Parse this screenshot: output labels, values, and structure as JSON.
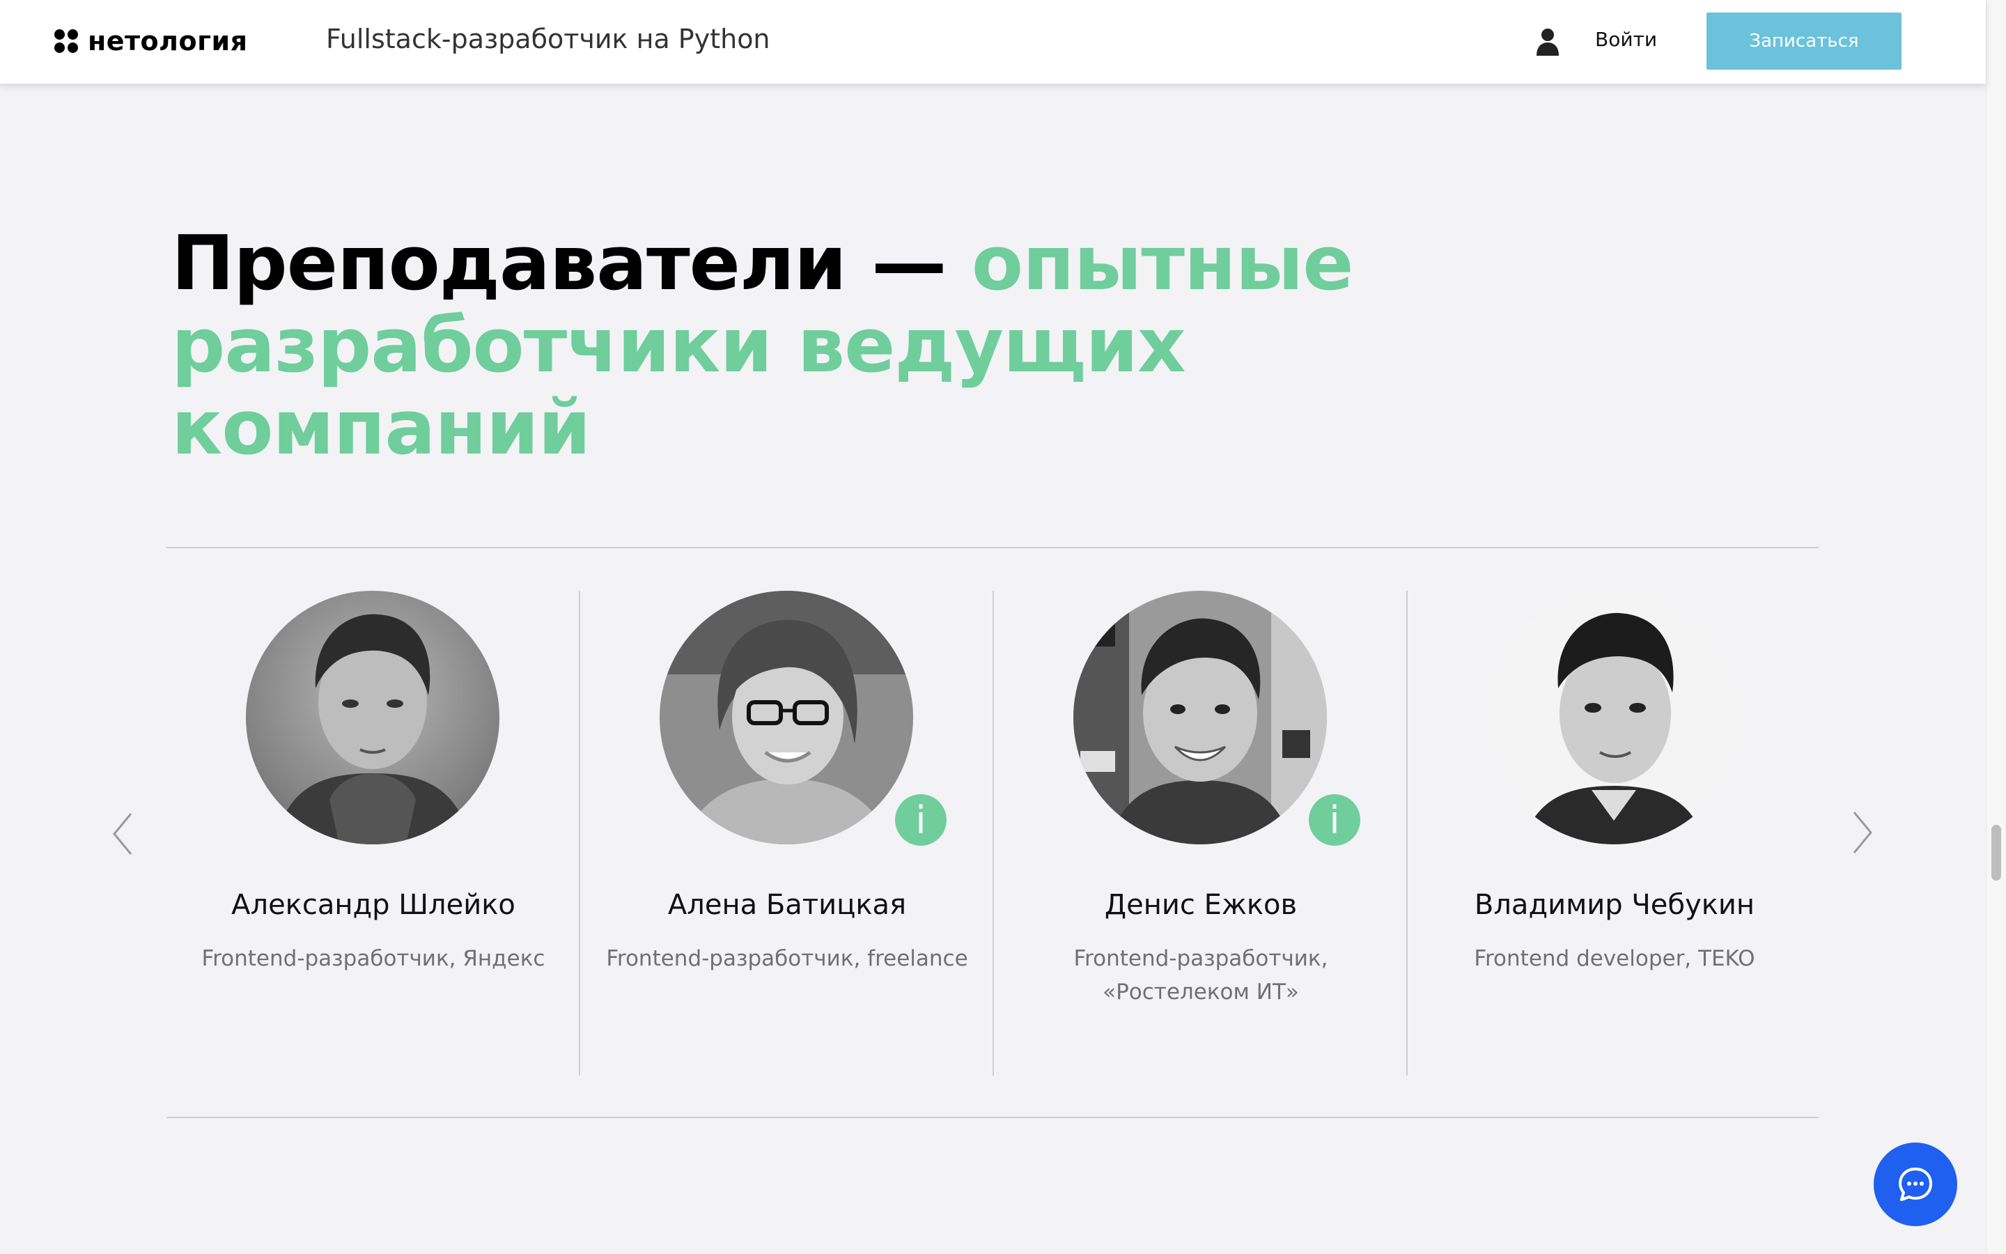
{
  "header": {
    "logo_text": "нетология",
    "course_title": "Fullstack-разработчик на Python",
    "login_label": "Войти",
    "signup_label": "Записаться",
    "icons": {
      "user": "user-icon",
      "logo": "logo-mark-icon"
    }
  },
  "section": {
    "heading_black": "Преподаватели — ",
    "heading_green": "опытные разработчики ведущих компаний"
  },
  "teachers": [
    {
      "name": "Александр Шлейко",
      "role": "Frontend-разработчик, Яндекс",
      "info": false
    },
    {
      "name": "Алена Батицкая",
      "role": "Frontend-разработчик, freelance",
      "info": true
    },
    {
      "name": "Денис Ежков",
      "role": "Frontend-разработчик, «Ростелеком ИТ»",
      "info": true
    },
    {
      "name": "Владимир Чебукин",
      "role": "Frontend developer, TEKO",
      "info": false
    }
  ],
  "carousel": {
    "prev_icon": "chevron-left-icon",
    "next_icon": "chevron-right-icon"
  },
  "chat": {
    "icon": "chat-bubble-icon"
  },
  "colors": {
    "accent_green": "#6fce9c",
    "signup_blue": "#6bc2db",
    "chat_blue": "#2060f0"
  }
}
